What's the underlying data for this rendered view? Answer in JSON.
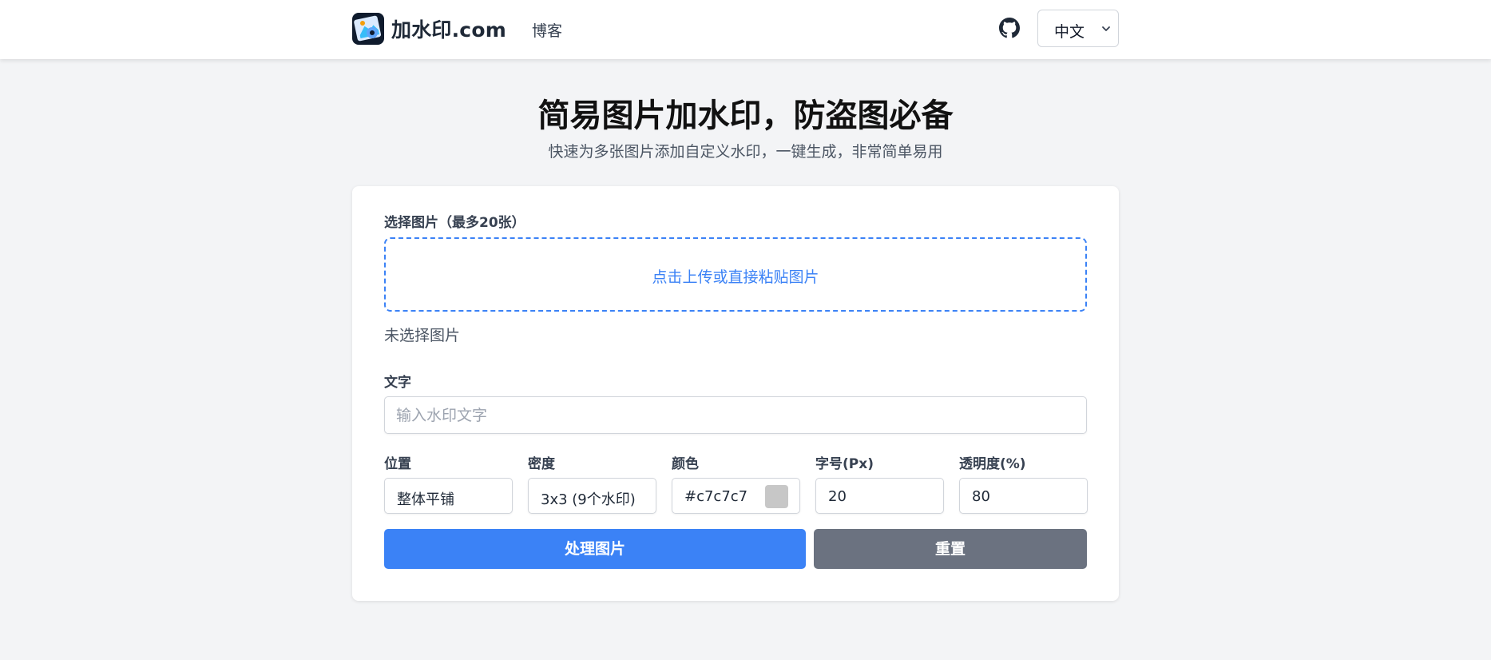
{
  "header": {
    "brand": "加水印.com",
    "nav_blog": "博客",
    "language": "中文"
  },
  "hero": {
    "title": "简易图片加水印，防盗图必备",
    "subtitle": "快速为多张图片添加自定义水印，一键生成，非常简单易用"
  },
  "form": {
    "image_label": "选择图片（最多20张）",
    "upload_hint": "点击上传或直接粘贴图片",
    "no_image": "未选择图片",
    "text_label": "文字",
    "text_placeholder": "输入水印文字",
    "text_value": "",
    "position_label": "位置",
    "position_value": "整体平铺",
    "density_label": "密度",
    "density_value": "3x3 (9个水印)",
    "color_label": "颜色",
    "color_value": "#c7c7c7",
    "fontsize_label": "字号(Px)",
    "fontsize_value": "20",
    "opacity_label": "透明度(%)",
    "opacity_value": "80",
    "process_button": "处理图片",
    "reset_button": "重置"
  },
  "colors": {
    "primary": "#3b82f6",
    "secondary": "#6b7280",
    "background": "#f3f4f6",
    "swatch": "#c7c7c7"
  },
  "icons": [
    "logo-icon",
    "github-icon",
    "chevron-down-icon"
  ]
}
